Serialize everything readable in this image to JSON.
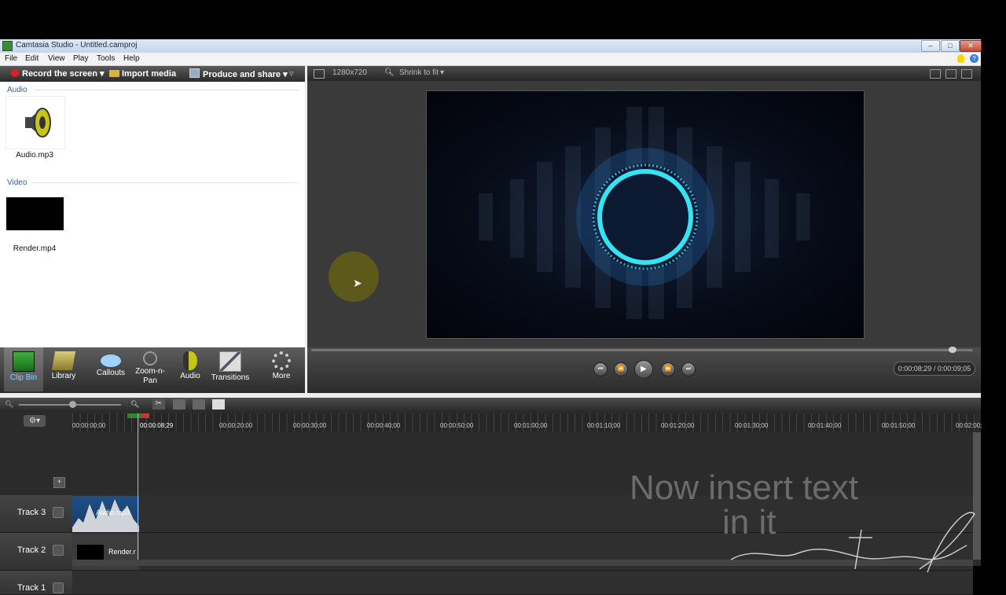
{
  "window": {
    "title": "Camtasia Studio - Untitled.camproj"
  },
  "menu": [
    "File",
    "Edit",
    "View",
    "Play",
    "Tools",
    "Help"
  ],
  "toolbar": {
    "record": "Record the screen",
    "import": "Import media",
    "produce": "Produce and share"
  },
  "clip_bin": {
    "audio_section": "Audio",
    "audio_clip": "Audio.mp3",
    "video_section": "Video",
    "video_clip": "Render.mp4"
  },
  "tabs": [
    {
      "label": "Clip Bin",
      "icon": "film-icon"
    },
    {
      "label": "Library",
      "icon": "library-icon"
    },
    {
      "label": "Callouts",
      "icon": "callout-icon"
    },
    {
      "label": "Zoom-n-Pan",
      "icon": "magnifier-icon"
    },
    {
      "label": "Audio",
      "icon": "speaker-icon"
    },
    {
      "label": "Transitions",
      "icon": "transitions-icon"
    },
    {
      "label": "More",
      "icon": "more-icon"
    }
  ],
  "preview": {
    "dimensions": "1280x720",
    "zoom": "Shrink to fit",
    "timecode": "0:00:08;29 / 0:00:09;05"
  },
  "timeline": {
    "playhead_time": "00:00:08;29",
    "ruler": [
      "00:00:00;00",
      "00:00:20;00",
      "00:00:30;00",
      "00:00:40;00",
      "00:00:50;00",
      "00:01:00;00",
      "00:01:10;00",
      "00:01:20;00",
      "00:01:30;00",
      "00:01:40;00",
      "00:01:50;00",
      "00:02:00;"
    ],
    "tracks": [
      {
        "label": "Track 3",
        "clip": "Audio.mp3"
      },
      {
        "label": "Track 2",
        "clip": "Render.r"
      },
      {
        "label": "Track 1",
        "clip": ""
      }
    ]
  },
  "overlay": {
    "line1": "Now insert text",
    "line2": "in it"
  }
}
